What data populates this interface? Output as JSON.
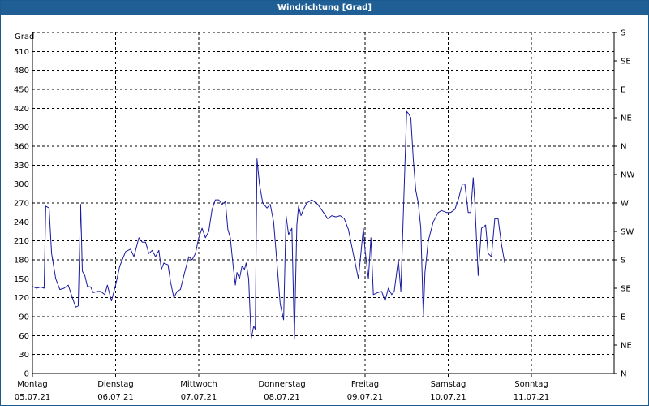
{
  "window": {
    "title": "Windrichtung [Grad]"
  },
  "chart_data": {
    "type": "line",
    "title": "Windrichtung [Grad]",
    "ylabel": "Grad",
    "ylim": [
      0,
      540
    ],
    "y_ticks": [
      0,
      30,
      60,
      90,
      120,
      150,
      180,
      210,
      240,
      270,
      300,
      330,
      360,
      390,
      420,
      450,
      480,
      510
    ],
    "right_axis_labels": [
      "N",
      "NE",
      "E",
      "SE",
      "S",
      "SW",
      "W",
      "NW",
      "N",
      "NE",
      "E",
      "SE",
      "S"
    ],
    "right_axis_values": [
      0,
      45,
      90,
      135,
      180,
      225,
      270,
      315,
      360,
      405,
      450,
      495,
      540
    ],
    "xlim": [
      0,
      7
    ],
    "x_unit": "days since Montag 05.07.21",
    "x_ticks": [
      {
        "day": "Montag",
        "date": "05.07.21"
      },
      {
        "day": "Dienstag",
        "date": "06.07.21"
      },
      {
        "day": "Mittwoch",
        "date": "07.07.21"
      },
      {
        "day": "Donnerstag",
        "date": "08.07.21"
      },
      {
        "day": "Freitag",
        "date": "09.07.21"
      },
      {
        "day": "Samstag",
        "date": "10.07.21"
      },
      {
        "day": "Sonntag",
        "date": "11.07.21"
      }
    ],
    "grid": true,
    "line_color": "#1a1aa0",
    "series": [
      {
        "name": "",
        "points": [
          [
            0.0,
            138
          ],
          [
            0.05,
            135
          ],
          [
            0.1,
            137
          ],
          [
            0.14,
            135
          ],
          [
            0.16,
            265
          ],
          [
            0.2,
            262
          ],
          [
            0.23,
            190
          ],
          [
            0.28,
            150
          ],
          [
            0.33,
            133
          ],
          [
            0.38,
            135
          ],
          [
            0.43,
            140
          ],
          [
            0.48,
            120
          ],
          [
            0.52,
            105
          ],
          [
            0.55,
            107
          ],
          [
            0.58,
            268
          ],
          [
            0.6,
            162
          ],
          [
            0.63,
            155
          ],
          [
            0.66,
            138
          ],
          [
            0.7,
            137
          ],
          [
            0.73,
            128
          ],
          [
            0.78,
            130
          ],
          [
            0.82,
            130
          ],
          [
            0.87,
            125
          ],
          [
            0.9,
            140
          ],
          [
            0.95,
            115
          ],
          [
            1.0,
            140
          ],
          [
            1.05,
            170
          ],
          [
            1.12,
            193
          ],
          [
            1.18,
            197
          ],
          [
            1.22,
            185
          ],
          [
            1.28,
            215
          ],
          [
            1.32,
            208
          ],
          [
            1.36,
            208
          ],
          [
            1.4,
            190
          ],
          [
            1.44,
            195
          ],
          [
            1.48,
            185
          ],
          [
            1.52,
            195
          ],
          [
            1.55,
            165
          ],
          [
            1.58,
            175
          ],
          [
            1.63,
            172
          ],
          [
            1.66,
            145
          ],
          [
            1.7,
            120
          ],
          [
            1.74,
            130
          ],
          [
            1.78,
            133
          ],
          [
            1.83,
            160
          ],
          [
            1.88,
            185
          ],
          [
            1.92,
            180
          ],
          [
            1.96,
            190
          ],
          [
            2.0,
            215
          ],
          [
            2.04,
            230
          ],
          [
            2.08,
            215
          ],
          [
            2.12,
            225
          ],
          [
            2.16,
            260
          ],
          [
            2.2,
            275
          ],
          [
            2.24,
            275
          ],
          [
            2.28,
            268
          ],
          [
            2.32,
            272
          ],
          [
            2.35,
            228
          ],
          [
            2.38,
            215
          ],
          [
            2.41,
            175
          ],
          [
            2.44,
            140
          ],
          [
            2.46,
            160
          ],
          [
            2.49,
            150
          ],
          [
            2.52,
            170
          ],
          [
            2.55,
            165
          ],
          [
            2.57,
            175
          ],
          [
            2.6,
            150
          ],
          [
            2.63,
            55
          ],
          [
            2.66,
            75
          ],
          [
            2.68,
            70
          ],
          [
            2.7,
            340
          ],
          [
            2.73,
            300
          ],
          [
            2.77,
            270
          ],
          [
            2.82,
            262
          ],
          [
            2.86,
            268
          ],
          [
            2.9,
            240
          ],
          [
            2.94,
            175
          ],
          [
            2.98,
            110
          ],
          [
            3.02,
            85
          ],
          [
            3.05,
            250
          ],
          [
            3.08,
            220
          ],
          [
            3.12,
            230
          ],
          [
            3.15,
            55
          ],
          [
            3.18,
            235
          ],
          [
            3.2,
            265
          ],
          [
            3.23,
            250
          ],
          [
            3.26,
            260
          ],
          [
            3.3,
            270
          ],
          [
            3.36,
            275
          ],
          [
            3.43,
            268
          ],
          [
            3.5,
            255
          ],
          [
            3.55,
            245
          ],
          [
            3.6,
            250
          ],
          [
            3.65,
            248
          ],
          [
            3.7,
            250
          ],
          [
            3.75,
            245
          ],
          [
            3.8,
            228
          ],
          [
            3.85,
            195
          ],
          [
            3.92,
            150
          ],
          [
            3.98,
            230
          ],
          [
            4.0,
            195
          ],
          [
            4.04,
            150
          ],
          [
            4.07,
            215
          ],
          [
            4.1,
            125
          ],
          [
            4.15,
            128
          ],
          [
            4.2,
            130
          ],
          [
            4.24,
            115
          ],
          [
            4.28,
            135
          ],
          [
            4.32,
            125
          ],
          [
            4.35,
            130
          ],
          [
            4.4,
            180
          ],
          [
            4.43,
            130
          ],
          [
            4.46,
            250
          ],
          [
            4.5,
            415
          ],
          [
            4.52,
            412
          ],
          [
            4.55,
            405
          ],
          [
            4.58,
            340
          ],
          [
            4.61,
            290
          ],
          [
            4.64,
            270
          ],
          [
            4.67,
            230
          ],
          [
            4.7,
            90
          ],
          [
            4.72,
            160
          ],
          [
            4.76,
            210
          ],
          [
            4.82,
            240
          ],
          [
            4.88,
            255
          ],
          [
            4.92,
            258
          ],
          [
            4.98,
            255
          ],
          [
            5.03,
            255
          ],
          [
            5.08,
            260
          ],
          [
            5.12,
            275
          ],
          [
            5.17,
            300
          ],
          [
            5.2,
            300
          ],
          [
            5.24,
            255
          ],
          [
            5.27,
            255
          ],
          [
            5.3,
            310
          ],
          [
            5.32,
            270
          ],
          [
            5.36,
            155
          ],
          [
            5.4,
            230
          ],
          [
            5.45,
            235
          ],
          [
            5.48,
            190
          ],
          [
            5.52,
            185
          ],
          [
            5.56,
            245
          ],
          [
            5.6,
            245
          ],
          [
            5.64,
            205
          ],
          [
            5.68,
            175
          ]
        ]
      }
    ]
  }
}
